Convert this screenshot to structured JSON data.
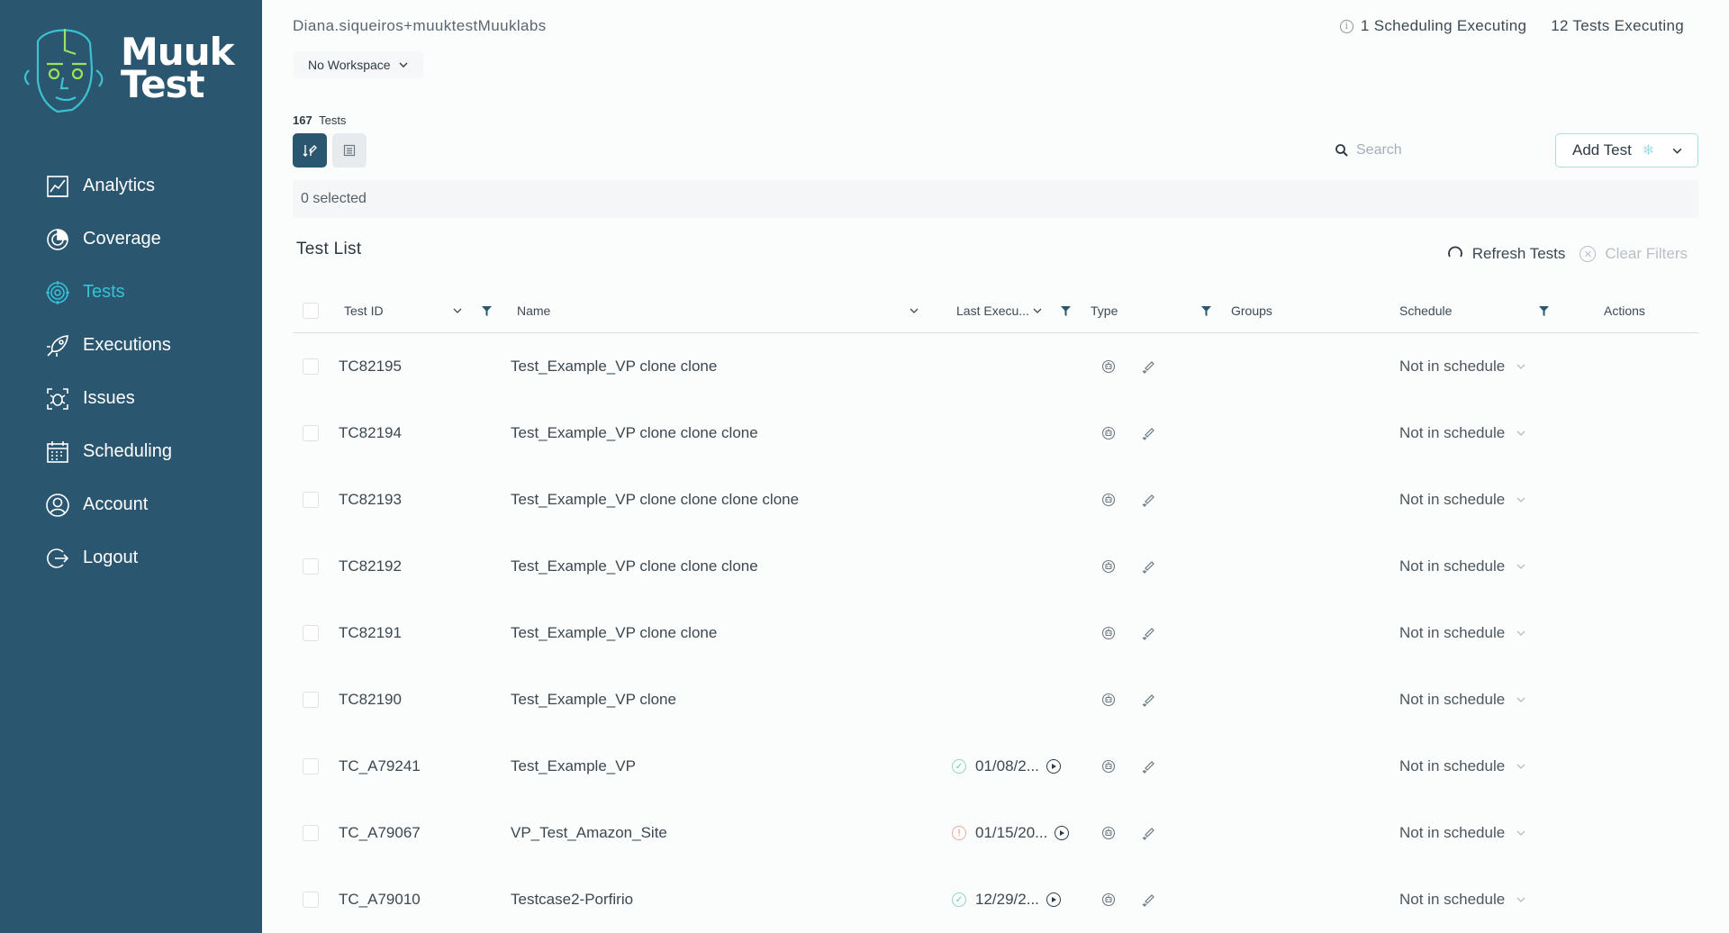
{
  "brand": {
    "name_line1": "Muuk",
    "name_line2": "Test"
  },
  "nav": [
    {
      "label": "Analytics",
      "icon": "analytics-icon",
      "active": false
    },
    {
      "label": "Coverage",
      "icon": "coverage-icon",
      "active": false
    },
    {
      "label": "Tests",
      "icon": "tests-icon",
      "active": true
    },
    {
      "label": "Executions",
      "icon": "executions-icon",
      "active": false
    },
    {
      "label": "Issues",
      "icon": "issues-icon",
      "active": false
    },
    {
      "label": "Scheduling",
      "icon": "scheduling-icon",
      "active": false
    },
    {
      "label": "Account",
      "icon": "account-icon",
      "active": false
    },
    {
      "label": "Logout",
      "icon": "logout-icon",
      "active": false
    }
  ],
  "header": {
    "user": "Diana.siqueiros+muuktestMuuklabs",
    "scheduling_status": "1 Scheduling Executing",
    "tests_status": "12 Tests Executing",
    "workspace": "No Workspace"
  },
  "summary": {
    "count": "167",
    "count_label": "Tests",
    "selected": "0 selected"
  },
  "toolbar": {
    "search_placeholder": "Search",
    "add_test_label": "Add Test"
  },
  "list": {
    "title": "Test List",
    "refresh_label": "Refresh Tests",
    "clear_label": "Clear Filters",
    "columns": {
      "test_id": "Test ID",
      "name": "Name",
      "last_exec": "Last Execu...",
      "type": "Type",
      "groups": "Groups",
      "schedule": "Schedule",
      "actions": "Actions"
    },
    "rows": [
      {
        "id": "TC82195",
        "name": "Test_Example_VP clone clone",
        "last_exec": "",
        "status": "",
        "schedule": "Not in schedule"
      },
      {
        "id": "TC82194",
        "name": "Test_Example_VP clone clone clone",
        "last_exec": "",
        "status": "",
        "schedule": "Not in schedule"
      },
      {
        "id": "TC82193",
        "name": "Test_Example_VP clone clone clone clone",
        "last_exec": "",
        "status": "",
        "schedule": "Not in schedule"
      },
      {
        "id": "TC82192",
        "name": "Test_Example_VP clone clone clone",
        "last_exec": "",
        "status": "",
        "schedule": "Not in schedule"
      },
      {
        "id": "TC82191",
        "name": "Test_Example_VP clone clone",
        "last_exec": "",
        "status": "",
        "schedule": "Not in schedule"
      },
      {
        "id": "TC82190",
        "name": "Test_Example_VP clone",
        "last_exec": "",
        "status": "",
        "schedule": "Not in schedule"
      },
      {
        "id": "TC_A79241",
        "name": "Test_Example_VP",
        "last_exec": "01/08/2...",
        "status": "ok",
        "schedule": "Not in schedule"
      },
      {
        "id": "TC_A79067",
        "name": "VP_Test_Amazon_Site",
        "last_exec": "01/15/20...",
        "status": "err",
        "schedule": "Not in schedule"
      },
      {
        "id": "TC_A79010",
        "name": "Testcase2-Porfirio",
        "last_exec": "12/29/2...",
        "status": "ok",
        "schedule": "Not in schedule"
      }
    ]
  },
  "colors": {
    "sidebar": "#2b5670",
    "accent": "#36c3d6",
    "success": "#6cc7ad",
    "error": "#e57a70"
  }
}
